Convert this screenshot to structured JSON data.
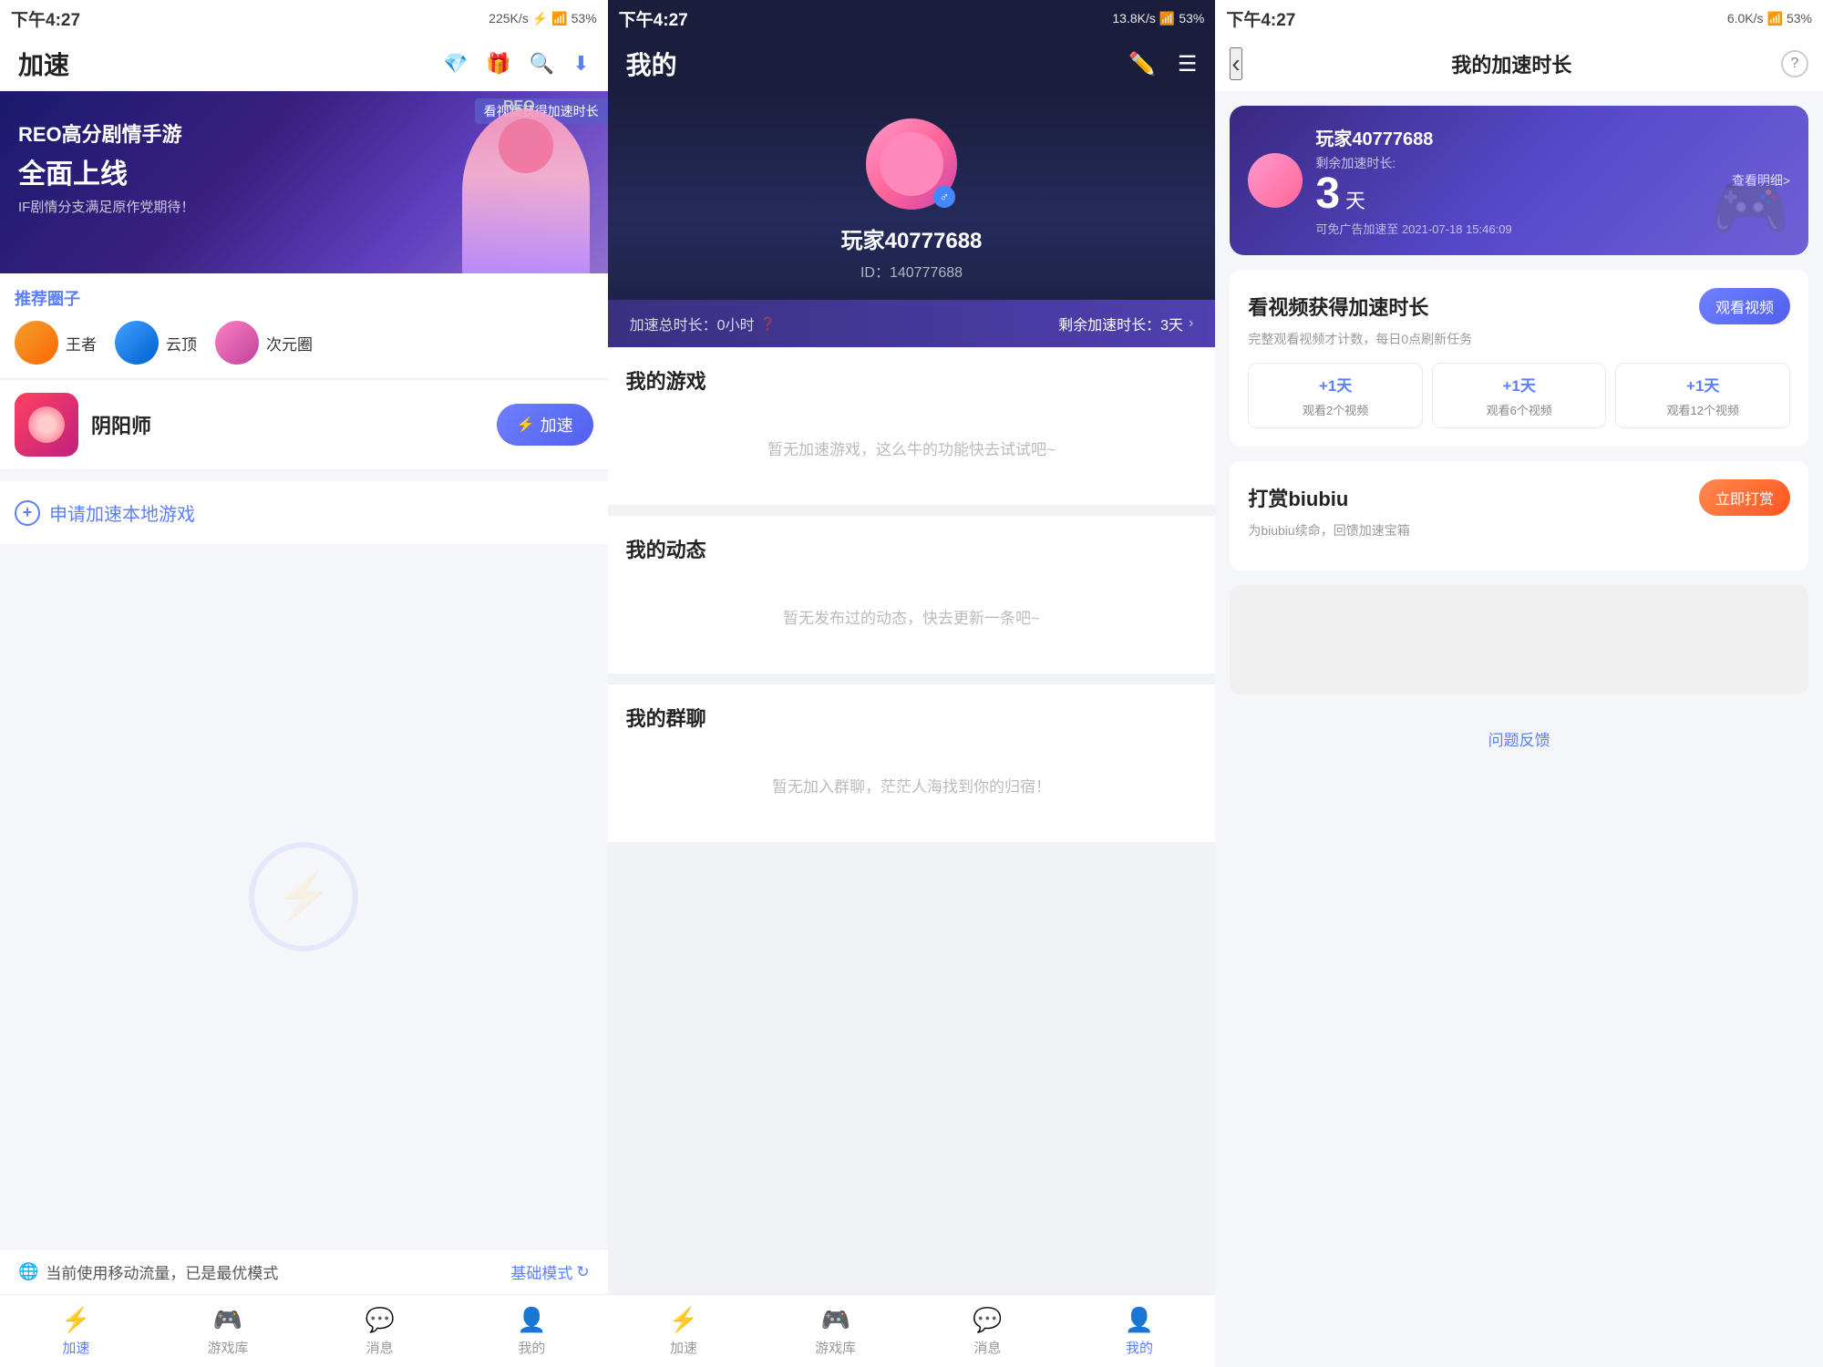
{
  "status": {
    "time": "下午4:27",
    "speed_p1": "225K/s",
    "speed_p2": "13.8K/s",
    "speed_p3": "6.0K/s",
    "battery": "53%",
    "icons": "🔵📶🔋"
  },
  "panel1": {
    "title": "加速",
    "banner": {
      "badge": "看视频获得加速时长",
      "reo_label": "REO",
      "line1": "REO高分剧情手游",
      "line2": "全面上线",
      "line3": "IF剧情分支满足原作党期待！"
    },
    "recommend": {
      "header": "推荐圈子",
      "items": [
        {
          "name": "王者"
        },
        {
          "name": "云顶"
        },
        {
          "name": "次元圈"
        }
      ]
    },
    "game": {
      "name": "阴阳师",
      "boost_label": "加速"
    },
    "apply": {
      "text": "申请加速本地游戏"
    },
    "status_bar": {
      "text": "当前使用移动流量，已是最优模式",
      "mode": "基础模式"
    },
    "nav": [
      {
        "label": "加速",
        "active": true
      },
      {
        "label": "游戏库",
        "active": false
      },
      {
        "label": "消息",
        "active": false
      },
      {
        "label": "我的",
        "active": false
      }
    ]
  },
  "panel2": {
    "title": "我的",
    "username": "玩家40777688",
    "user_id": "ID：140777688",
    "gender": "♂",
    "time_bar": {
      "total_label": "加速总时长：0小时",
      "remain_label": "剩余加速时长：3天"
    },
    "sections": [
      {
        "title": "我的游戏",
        "empty": "暂无加速游戏，这么牛的功能快去试试吧~"
      },
      {
        "title": "我的动态",
        "empty": "暂无发布过的动态，快去更新一条吧~"
      },
      {
        "title": "我的群聊",
        "empty": "暂无加入群聊，茫茫人海找到你的归宿！"
      }
    ],
    "nav": [
      {
        "label": "加速",
        "active": false
      },
      {
        "label": "游戏库",
        "active": false
      },
      {
        "label": "消息",
        "active": false
      },
      {
        "label": "我的",
        "active": true
      }
    ]
  },
  "panel3": {
    "back_label": "‹",
    "title": "我的加速时长",
    "help_label": "?",
    "user_card": {
      "name": "玩家40777688",
      "remain_label": "剩余加速时长:",
      "days": "3",
      "days_unit": "天",
      "date_label": "可免广告加速至 2021-07-18 15:46:09",
      "detail_label": "查看明细>"
    },
    "video_section": {
      "title": "看视频获得加速时长",
      "desc": "完整观看视频才计数，每日0点刷新任务",
      "watch_btn": "观看视频",
      "steps": [
        {
          "plus": "+1天",
          "label": "观看2个视频"
        },
        {
          "plus": "+1天",
          "label": "观看6个视频"
        },
        {
          "plus": "+1天",
          "label": "观看12个视频"
        }
      ]
    },
    "reward_section": {
      "title": "打赏biubiu",
      "desc": "为biubiu续命，回馈加速宝箱",
      "btn": "立即打赏"
    },
    "feedback": "问题反馈"
  }
}
